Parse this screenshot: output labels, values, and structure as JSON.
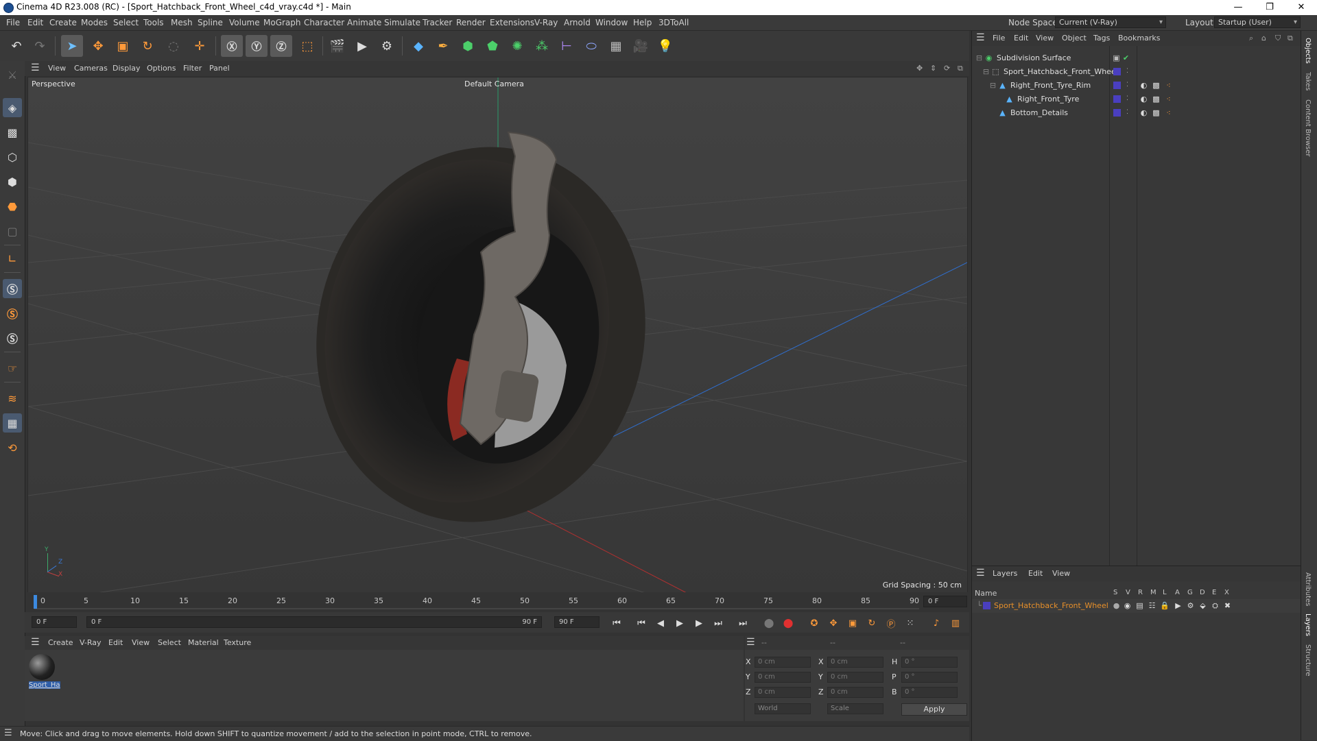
{
  "window": {
    "title": "Cinema 4D R23.008 (RC) - [Sport_Hatchback_Front_Wheel_c4d_vray.c4d *] - Main",
    "minimize": "—",
    "maximize": "❐",
    "close": "✕"
  },
  "menubar": {
    "items": [
      "File",
      "Edit",
      "Create",
      "Modes",
      "Select",
      "Tools",
      "Mesh",
      "Spline",
      "Volume",
      "MoGraph",
      "Character",
      "Animate",
      "Simulate",
      "Tracker",
      "Render",
      "Extensions",
      "V-Ray",
      "Arnold",
      "Window",
      "Help",
      "3DToAll"
    ],
    "node_space_label": "Node Space:",
    "node_space_value": "Current (V-Ray)",
    "layout_label": "Layout:",
    "layout_value": "Startup (User)"
  },
  "viewport": {
    "menu": [
      "View",
      "Cameras",
      "Display",
      "Options",
      "Filter",
      "Panel"
    ],
    "projection": "Perspective",
    "camera": "Default Camera",
    "grid_spacing": "Grid Spacing : 50 cm",
    "axis": {
      "y": "Y",
      "z": "Z",
      "x": "X"
    }
  },
  "timeline": {
    "ticks": [
      "0",
      "5",
      "10",
      "15",
      "20",
      "25",
      "30",
      "35",
      "40",
      "45",
      "50",
      "55",
      "60",
      "65",
      "70",
      "75",
      "80",
      "85",
      "90"
    ],
    "current_frame_field": "0 F",
    "start_field": "0 F",
    "range_start": "0 F",
    "range_end": "90 F",
    "end_field": "90 F"
  },
  "material_manager": {
    "menu": [
      "Create",
      "V-Ray",
      "Edit",
      "View",
      "Select",
      "Material",
      "Texture"
    ],
    "materials": [
      {
        "name": "Sport_Ha"
      }
    ]
  },
  "coordinates": {
    "headers": [
      "--",
      "--",
      "--"
    ],
    "rows": [
      {
        "a_label": "X",
        "a_val": "0 cm",
        "b_label": "X",
        "b_val": "0 cm",
        "c_label": "H",
        "c_val": "0 °"
      },
      {
        "a_label": "Y",
        "a_val": "0 cm",
        "b_label": "Y",
        "b_val": "0 cm",
        "c_label": "P",
        "c_val": "0 °"
      },
      {
        "a_label": "Z",
        "a_val": "0 cm",
        "b_label": "Z",
        "b_val": "0 cm",
        "c_label": "B",
        "c_val": "0 °"
      }
    ],
    "world": "World",
    "scale": "Scale",
    "apply": "Apply"
  },
  "status": "Move: Click and drag to move elements. Hold down SHIFT to quantize movement / add to the selection in point mode, CTRL to remove.",
  "object_manager": {
    "menu": [
      "File",
      "Edit",
      "View",
      "Object",
      "Tags",
      "Bookmarks"
    ],
    "objects": [
      {
        "name": "Subdivision Surface"
      },
      {
        "name": "Sport_Hatchback_Front_Wheel"
      },
      {
        "name": "Right_Front_Tyre_Rim"
      },
      {
        "name": "Right_Front_Tyre"
      },
      {
        "name": "Bottom_Details"
      }
    ]
  },
  "layers": {
    "menu": [
      "Layers",
      "Edit",
      "View"
    ],
    "name_header": "Name",
    "columns": [
      "S",
      "V",
      "R",
      "M",
      "L",
      "A",
      "G",
      "D",
      "E",
      "X"
    ],
    "items": [
      {
        "name": "Sport_Hatchback_Front_Wheel",
        "color": "#4a3fbf"
      }
    ]
  },
  "side_tabs": [
    "Objects",
    "Takes",
    "Content Browser",
    "Attributes",
    "Layers",
    "Structure"
  ],
  "colors": {
    "accent_orange": "#e8902a",
    "selection_blue": "#4a5a70",
    "layer_color": "#4a3fbf"
  }
}
